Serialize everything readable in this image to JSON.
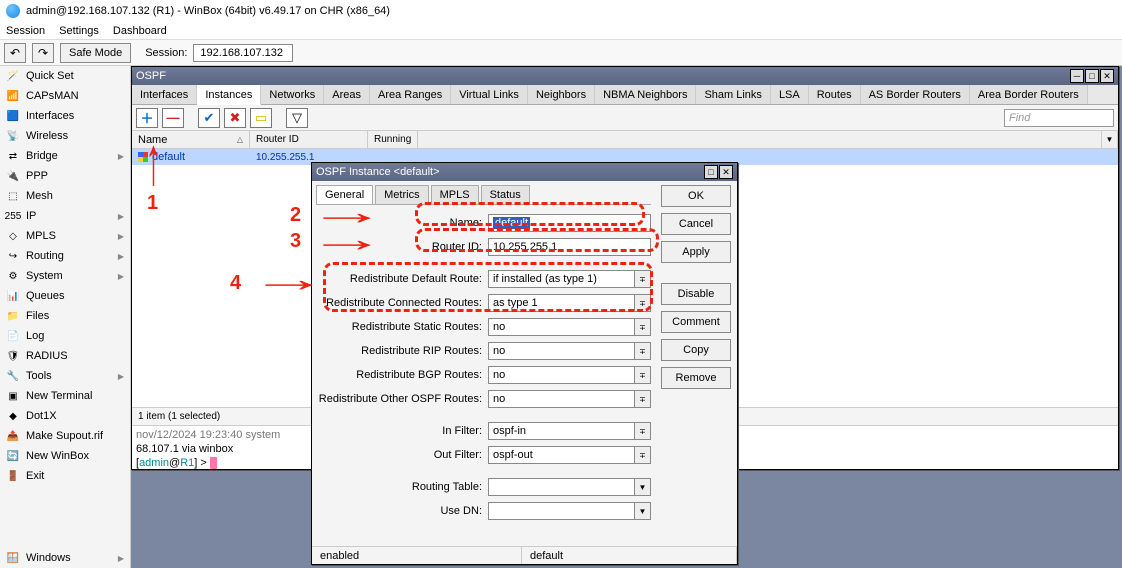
{
  "window": {
    "title": "admin@192.168.107.132 (R1) - WinBox (64bit) v6.49.17 on CHR (x86_64)"
  },
  "menubar": [
    "Session",
    "Settings",
    "Dashboard"
  ],
  "toolbar": {
    "safe_mode": "Safe Mode",
    "session_label": "Session:",
    "session_ip": "192.168.107.132"
  },
  "sidebar": [
    {
      "label": "Quick Set",
      "icon": "🪄"
    },
    {
      "label": "CAPsMAN",
      "icon": "📶"
    },
    {
      "label": "Interfaces",
      "icon": "🟦"
    },
    {
      "label": "Wireless",
      "icon": "📡"
    },
    {
      "label": "Bridge",
      "icon": "⇄",
      "sub": true
    },
    {
      "label": "PPP",
      "icon": "🔌"
    },
    {
      "label": "Mesh",
      "icon": "⬚"
    },
    {
      "label": "IP",
      "icon": "255",
      "sub": true
    },
    {
      "label": "MPLS",
      "icon": "◇",
      "sub": true
    },
    {
      "label": "Routing",
      "icon": "↪",
      "sub": true
    },
    {
      "label": "System",
      "icon": "⚙",
      "sub": true
    },
    {
      "label": "Queues",
      "icon": "📊"
    },
    {
      "label": "Files",
      "icon": "📁"
    },
    {
      "label": "Log",
      "icon": "📄"
    },
    {
      "label": "RADIUS",
      "icon": "🛡"
    },
    {
      "label": "Tools",
      "icon": "🔧",
      "sub": true
    },
    {
      "label": "New Terminal",
      "icon": "▣"
    },
    {
      "label": "Dot1X",
      "icon": "◆"
    },
    {
      "label": "Make Supout.rif",
      "icon": "📤"
    },
    {
      "label": "New WinBox",
      "icon": "🔄"
    },
    {
      "label": "Exit",
      "icon": "🚪"
    }
  ],
  "sidebar_footer": {
    "label": "Windows",
    "icon": "🪟"
  },
  "ospf_window": {
    "title": "OSPF",
    "tabs": [
      "Interfaces",
      "Instances",
      "Networks",
      "Areas",
      "Area Ranges",
      "Virtual Links",
      "Neighbors",
      "NBMA Neighbors",
      "Sham Links",
      "LSA",
      "Routes",
      "AS Border Routers",
      "Area Border Routers"
    ],
    "active_tab": 1,
    "find_placeholder": "Find",
    "columns": {
      "name": "Name",
      "router_id": "Router ID",
      "running": "Running"
    },
    "row": {
      "name": "default",
      "router_id": "10.255.255.1"
    },
    "status": "1 item (1 selected)"
  },
  "terminal": {
    "line1_gray": "nov/12/2024 19:23:40 system",
    "line2": "68.107.1 via winbox",
    "prompt_open": "[",
    "prompt_user": "admin",
    "prompt_at": "@",
    "prompt_host": "R1",
    "prompt_close": "] > "
  },
  "dialog": {
    "title": "OSPF Instance <default>",
    "tabs": [
      "General",
      "Metrics",
      "MPLS",
      "Status"
    ],
    "active_tab": 0,
    "buttons": [
      "OK",
      "Cancel",
      "Apply",
      "Disable",
      "Comment",
      "Copy",
      "Remove"
    ],
    "fields": {
      "name_label": "Name:",
      "name_value": "default",
      "router_id_label": "Router ID:",
      "router_id_value": "10.255.255.1",
      "redist_default_label": "Redistribute Default Route:",
      "redist_default_value": "if installed (as type 1)",
      "redist_connected_label": "Redistribute Connected Routes:",
      "redist_connected_value": "as type 1",
      "redist_static_label": "Redistribute Static Routes:",
      "redist_static_value": "no",
      "redist_rip_label": "Redistribute RIP Routes:",
      "redist_rip_value": "no",
      "redist_bgp_label": "Redistribute BGP Routes:",
      "redist_bgp_value": "no",
      "redist_other_label": "Redistribute Other OSPF Routes:",
      "redist_other_value": "no",
      "in_filter_label": "In Filter:",
      "in_filter_value": "ospf-in",
      "out_filter_label": "Out Filter:",
      "out_filter_value": "ospf-out",
      "routing_table_label": "Routing Table:",
      "routing_table_value": "",
      "use_dn_label": "Use DN:",
      "use_dn_value": ""
    },
    "status": {
      "left": "enabled",
      "right": "default"
    }
  },
  "annotations": {
    "n1": "1",
    "n2": "2",
    "n3": "3",
    "n4": "4"
  }
}
